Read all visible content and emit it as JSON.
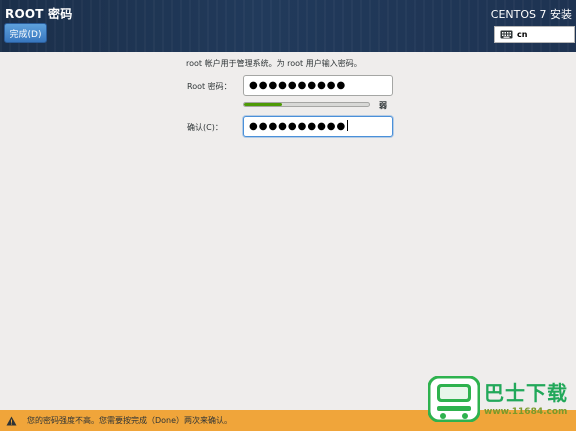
{
  "header": {
    "spoke_title": "ROOT 密码",
    "done_label": "完成(D)",
    "product_title": "CENTOS 7 安装",
    "keyboard_layout": "cn"
  },
  "form": {
    "intro_text": "root 帐户用于管理系统。为 root 用户输入密码。",
    "password_label": "Root 密码：",
    "password_value": "●●●●●●●●●●",
    "strength_level": 0.3,
    "strength_text": "弱",
    "confirm_label": "确认(C)：",
    "confirm_value": "●●●●●●●●●●"
  },
  "warning": {
    "icon": "warning-icon",
    "text": "您的密码强度不高。您需要按完成（Done）两次来确认。"
  },
  "watermark": {
    "site_name": "巴士下载",
    "site_url": "www.11684.com"
  },
  "colors": {
    "header_bg": "#1f3655",
    "accent_blue": "#3877bf",
    "strength_fill": "#4e9a06",
    "warning_bg": "#f0a53a"
  }
}
